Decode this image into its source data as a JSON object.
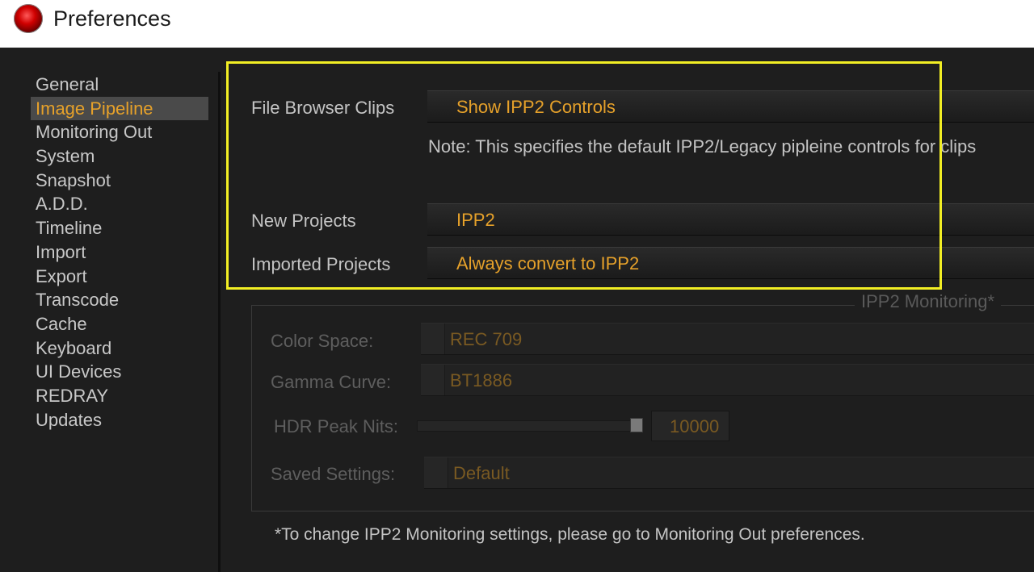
{
  "window": {
    "title": "Preferences",
    "icon": "red-record-icon"
  },
  "sidebar": {
    "items": [
      {
        "label": "General"
      },
      {
        "label": "Image Pipeline",
        "active": true
      },
      {
        "label": "Monitoring Out"
      },
      {
        "label": "System"
      },
      {
        "label": "Snapshot"
      },
      {
        "label": "A.D.D."
      },
      {
        "label": "Timeline"
      },
      {
        "label": "Import"
      },
      {
        "label": "Export"
      },
      {
        "label": "Transcode"
      },
      {
        "label": "Cache"
      },
      {
        "label": "Keyboard"
      },
      {
        "label": "UI Devices"
      },
      {
        "label": "REDRAY"
      },
      {
        "label": "Updates"
      }
    ]
  },
  "pipeline": {
    "file_browser_clips": {
      "label": "File Browser Clips",
      "value": "Show IPP2 Controls"
    },
    "note": "Note: This specifies the default IPP2/Legacy pipleine controls for clips",
    "new_projects": {
      "label": "New Projects",
      "value": "IPP2"
    },
    "imported_projects": {
      "label": "Imported Projects",
      "value": "Always convert to IPP2"
    }
  },
  "monitoring": {
    "title": "IPP2 Monitoring*",
    "color_space": {
      "label": "Color Space:",
      "value": "REC 709"
    },
    "gamma_curve": {
      "label": "Gamma Curve:",
      "value": "BT1886"
    },
    "hdr_peak_nits": {
      "label": "HDR Peak Nits:",
      "value": "10000",
      "slider_fraction": 1.0
    },
    "saved_settings": {
      "label": "Saved Settings:",
      "value": "Default"
    }
  },
  "footer_note": "*To change IPP2 Monitoring settings, please go to Monitoring Out preferences.",
  "colors": {
    "accent": "#e6a12a",
    "highlight": "#f2ee24",
    "background": "#1e1e1e"
  }
}
